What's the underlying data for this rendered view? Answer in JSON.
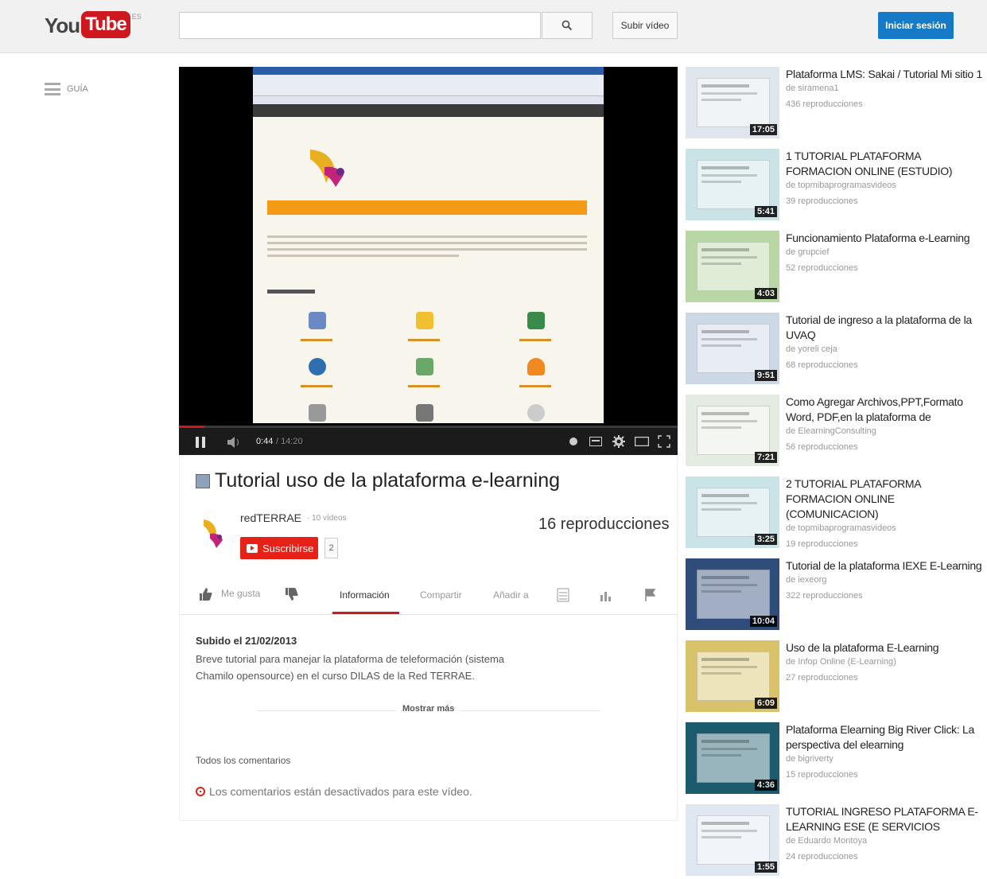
{
  "header": {
    "logo_you": "You",
    "logo_tube": "Tube",
    "country": "ES",
    "upload_label": "Subir vídeo",
    "signin_label": "Iniciar sesión"
  },
  "guide": {
    "label": "GUÍA"
  },
  "player": {
    "current_time": "0:44",
    "total_time": "/ 14:20",
    "progress_fraction": 0.051
  },
  "video": {
    "title": "Tutorial uso de la plataforma e-learning",
    "owner": "redTERRAE",
    "owner_videos": "· 10 vídeos",
    "subscribe_label": "Suscribirse",
    "subscriber_count": "2",
    "views": "16 reproducciones"
  },
  "actions": {
    "like": "Me gusta",
    "tab_info": "Información",
    "tab_share": "Compartir",
    "tab_add": "Añadir a"
  },
  "description": {
    "uploaded": "Subido el 21/02/2013",
    "text": "Breve tutorial para manejar la plataforma de teleformación (sistema Chamilo opensource) en el curso DILAS de la Red TERRAE.",
    "show_more": "Mostrar más"
  },
  "comments": {
    "heading": "Todos los comentarios",
    "disabled": "Los comentarios están desactivados para este vídeo."
  },
  "related": [
    {
      "title": "Plataforma LMS: Sakai / Tutorial Mi sitio 1",
      "by": "de siramena1",
      "views": "436 reproducciones",
      "duration": "17:05",
      "color": "#dfe6ee"
    },
    {
      "title": "1 TUTORIAL PLATAFORMA FORMACION ONLINE (ESTUDIO)",
      "by": "de topmibaprogramasvideos",
      "views": "39 reproducciones",
      "duration": "5:41",
      "color": "#c9e3e6"
    },
    {
      "title": "Funcionamiento Plataforma e-Learning",
      "by": "de grupcief",
      "views": "52 reproducciones",
      "duration": "4:03",
      "color": "#b9d6a5"
    },
    {
      "title": "Tutorial de ingreso a la plataforma de la UVAQ",
      "by": "de yoreli ceja",
      "views": "68 reproducciones",
      "duration": "9:51",
      "color": "#cdd8e6"
    },
    {
      "title": "Como Agregar Archivos,PPT,Formato Word, PDF,en la plataforma de",
      "by": "de ElearningConsulting",
      "views": "56 reproducciones",
      "duration": "7:21",
      "color": "#e4ebe1"
    },
    {
      "title": "2 TUTORIAL PLATAFORMA FORMACION ONLINE (COMUNICACION)",
      "by": "de topmibaprogramasvideos",
      "views": "19 reproducciones",
      "duration": "3:25",
      "color": "#c9e3e6"
    },
    {
      "title": "Tutorial de la plataforma IEXE E-Learning",
      "by": "de iexeorg",
      "views": "322 reproducciones",
      "duration": "10:04",
      "color": "#2f4c7a"
    },
    {
      "title": "Uso de la plataforma E-Learning",
      "by": "de Infop Online (E-Learning)",
      "views": "27 reproducciones",
      "duration": "6:09",
      "color": "#d8c36a"
    },
    {
      "title": "Plataforma Elearning Big River Click: La perspectiva del elearning",
      "by": "de bigriverty",
      "views": "15 reproducciones",
      "duration": "4:36",
      "color": "#1c5a6e"
    },
    {
      "title": "TUTORIAL INGRESO PLATAFORMA E-LEARNING ESE (E SERVICIOS",
      "by": "de Eduardo Montoya",
      "views": "24 reproducciones",
      "duration": "1:55",
      "color": "#dfe7f0"
    }
  ]
}
